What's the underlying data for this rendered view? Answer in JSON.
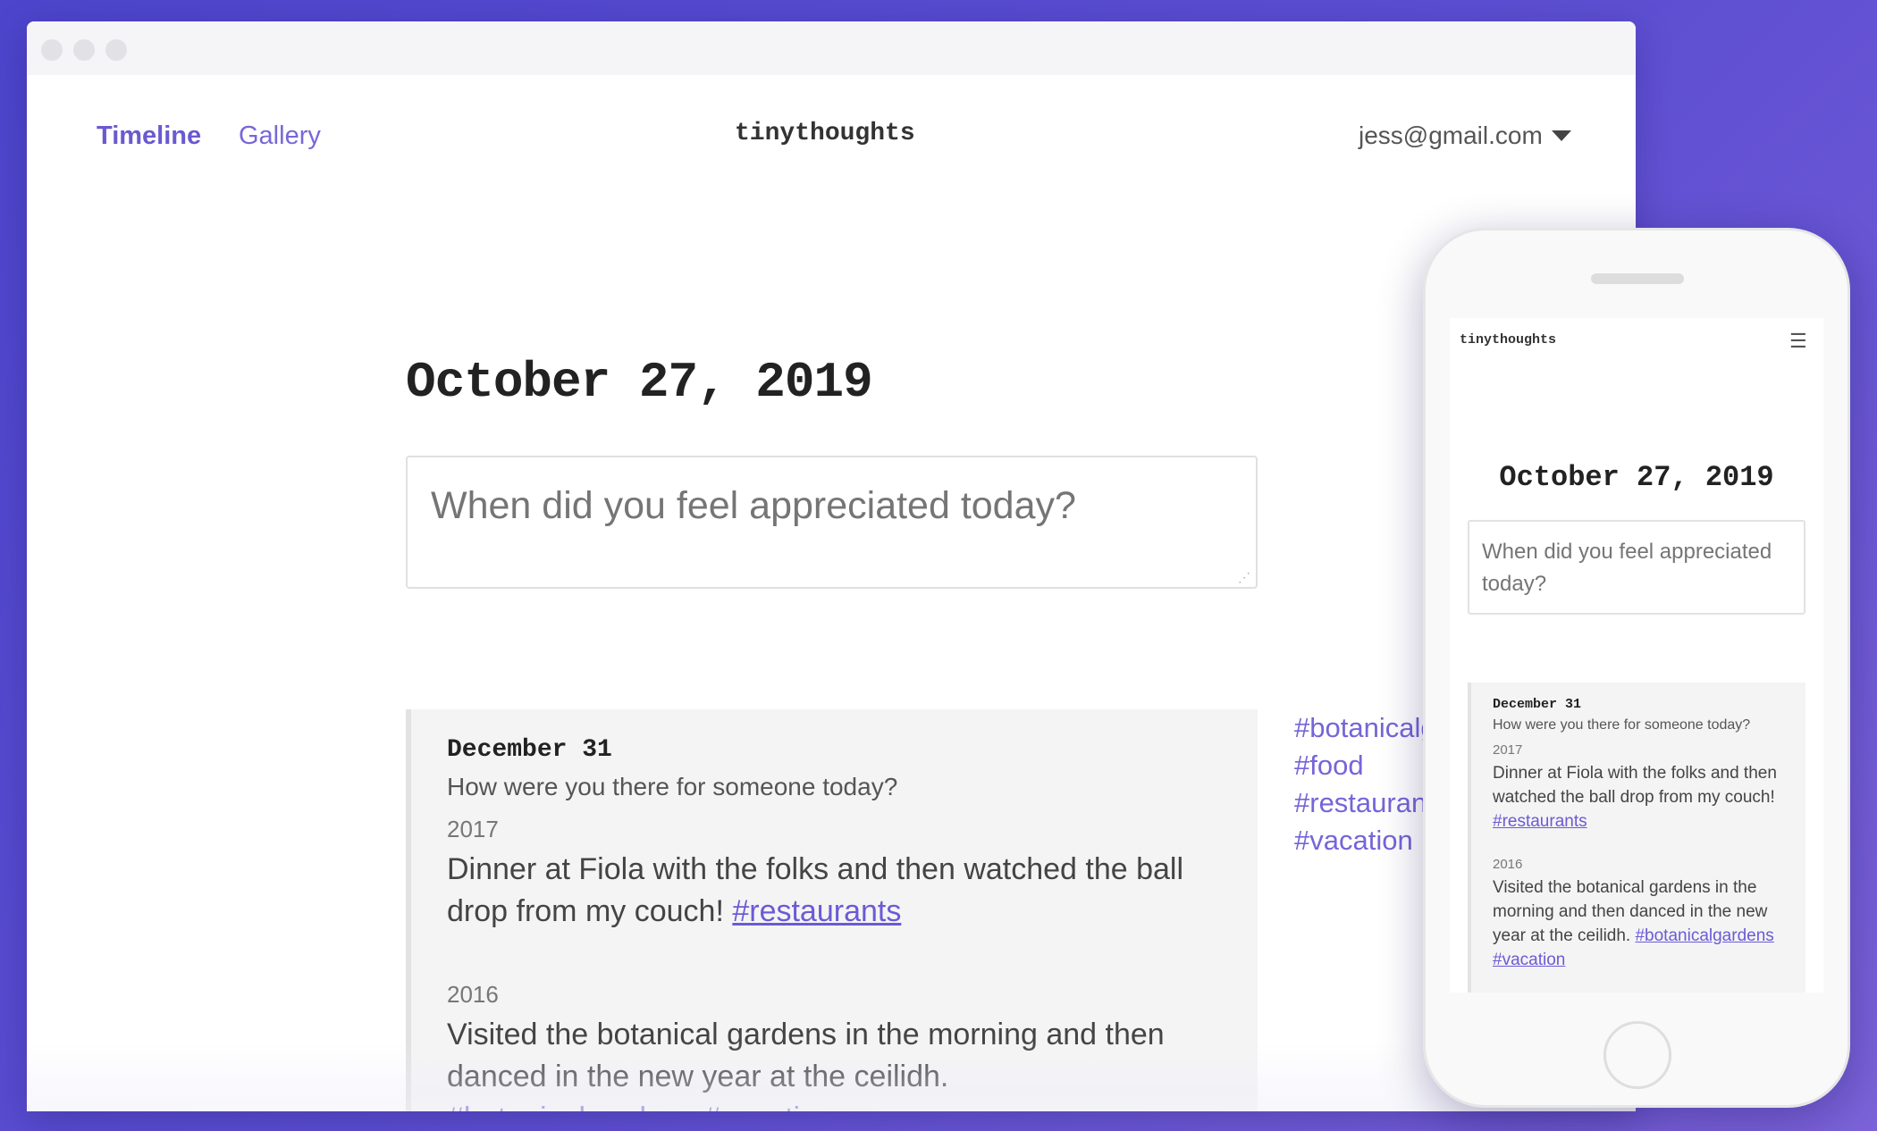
{
  "desktop": {
    "nav": {
      "timeline": "Timeline",
      "gallery": "Gallery",
      "brand": "tinythoughts",
      "account": "jess@gmail.com"
    },
    "date_heading": "October 27, 2019",
    "prompt_placeholder": "When did you feel appreciated today?",
    "memory": {
      "date": "December 31",
      "question": "How were you there for someone today?",
      "entries": [
        {
          "year": "2017",
          "text": "Dinner at Fiola with the folks and then watched the ball drop from my couch!",
          "tags": [
            "#restaurants"
          ]
        },
        {
          "year": "2016",
          "text": "Visited the botanical gardens in the morning and then danced in the new year at the ceilidh.",
          "tags": [
            "#botanicalgardens",
            "#vacation"
          ]
        }
      ]
    },
    "tag_list": [
      "#botanicalgardens",
      "#food",
      "#restaurants",
      "#vacation"
    ]
  },
  "mobile": {
    "brand": "tinythoughts",
    "menu_icon": "hamburger-menu-icon",
    "date_heading": "October 27, 2019",
    "prompt_placeholder": "When did you feel appreciated today?",
    "memory": {
      "date": "December 31",
      "question": "How were you there for someone today?",
      "entries": [
        {
          "year": "2017",
          "text": "Dinner at Fiola with the folks and then watched the ball drop from my couch!",
          "tags": [
            "#restaurants"
          ]
        },
        {
          "year": "2016",
          "text": "Visited the botanical gardens in the morning and then danced in the new year at the ceilidh.",
          "tags": [
            "#botanicalgardens",
            "#vacation"
          ]
        }
      ]
    }
  },
  "colors": {
    "background_start": "#4d45cc",
    "background_end": "#7b62d8",
    "accent": "#7767d8",
    "card_bg": "#f4f4f4"
  }
}
